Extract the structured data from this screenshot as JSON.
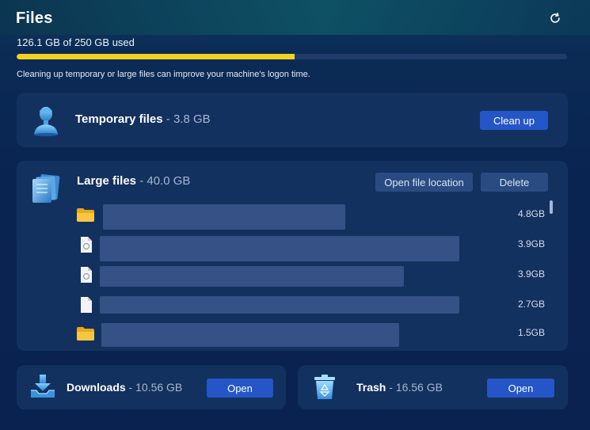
{
  "header": {
    "title": "Files",
    "refresh_icon": "refresh-icon"
  },
  "storage": {
    "used_text": "126.1 GB of 250 GB used",
    "used_fraction": 0.5044,
    "bar_color": "#f2d21c",
    "hint": "Cleaning up temporary or large files can improve your machine's logon time."
  },
  "temporary": {
    "icon": "person-bust-icon",
    "title": "Temporary files",
    "size": " - 3.8 GB",
    "clean_label": "Clean up"
  },
  "large": {
    "icon": "file-stack-icon",
    "title": "Large files",
    "size": " - 40.0 GB",
    "open_location_label": "Open file location",
    "delete_label": "Delete",
    "files": [
      {
        "icon": "folder-icon",
        "size": "4.8GB"
      },
      {
        "icon": "document-icon",
        "size": "3.9GB"
      },
      {
        "icon": "document-icon",
        "size": "3.9GB"
      },
      {
        "icon": "blank-file-icon",
        "size": "2.7GB"
      },
      {
        "icon": "folder-icon",
        "size": "1.5GB"
      }
    ]
  },
  "downloads": {
    "icon": "download-tray-icon",
    "title": "Downloads",
    "size": " - 10.56 GB",
    "open_label": "Open"
  },
  "trash": {
    "icon": "recycle-bin-icon",
    "title": "Trash",
    "size": " - 16.56 GB",
    "open_label": "Open"
  },
  "colors": {
    "accent": "#2456c8",
    "card": "#13315f",
    "background": "#0a2250"
  }
}
